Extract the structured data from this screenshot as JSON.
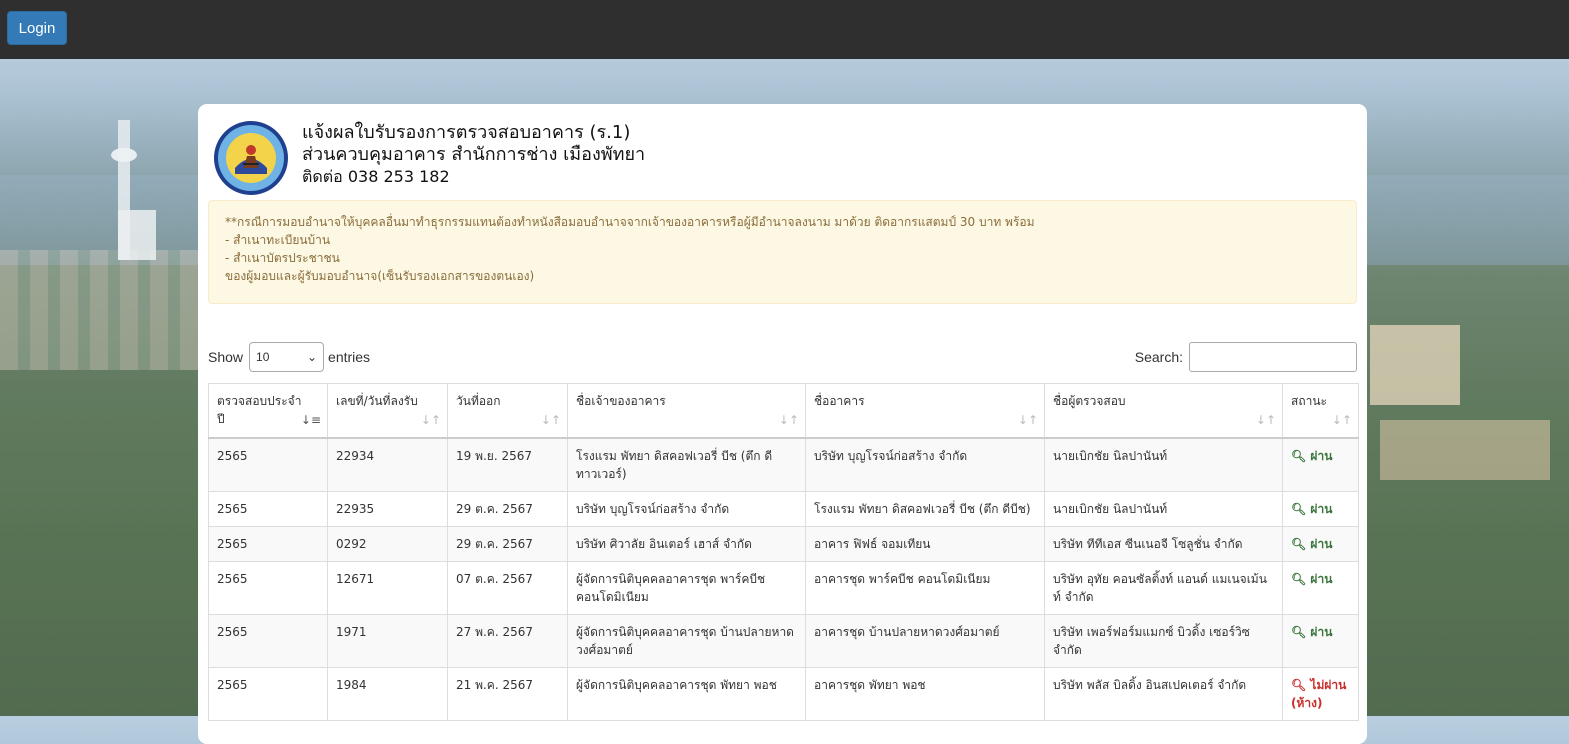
{
  "navbar": {
    "login_label": "Login"
  },
  "header": {
    "line1": "แจ้งผลใบรับรองการตรวจสอบอาคาร (ร.1)",
    "line2": "ส่วนควบคุมอาคาร สำนักการช่าง เมืองพัทยา",
    "contact": "ติดต่อ 038 253 182"
  },
  "notice": {
    "line1": "**กรณีการมอบอำนาจให้บุคคลอื่นมาทำธุรกรรมแทนต้องทำหนังสือมอบอำนาจจากเจ้าของอาคารหรือผู้มีอำนาจลงนาม มาด้วย ติดอากรแสตมป์ 30 บาท พร้อม",
    "line2": "- สำเนาทะเบียนบ้าน",
    "line3": "- สำเนาบัตรประชาชน",
    "line4": "ของผู้มอบและผู้รับมอบอำนาจ(เซ็นรับรองเอกสารของตนเอง)"
  },
  "controls": {
    "show_label": "Show",
    "show_value": "10",
    "entries_label": "entries",
    "search_label": "Search:",
    "search_value": ""
  },
  "table": {
    "headers": [
      "ตรวจสอบประจำปี",
      "เลขที่/วันที่ลงรับ",
      "วันที่ออก",
      "ชื่อเจ้าของอาคาร",
      "ชื่ออาคาร",
      "ชื่อผู้ตรวจสอบ",
      "สถานะ"
    ],
    "rows": [
      [
        "2565",
        "22934",
        "19 พ.ย. 2567",
        "โรงแรม พัทยา ดิสคอฟเวอรี่ บีช (ตึก ดีทาวเวอร์)",
        "บริษัท บุญโรจน์ก่อสร้าง จำกัด",
        "นายเบิกชัย นิลปานันท์",
        "ผ่าน"
      ],
      [
        "2565",
        "22935",
        "29 ต.ค. 2567",
        "บริษัท บุญโรจน์ก่อสร้าง จำกัด",
        "โรงแรม พัทยา ดิสคอฟเวอรี่ บีช (ตึก ดีบีช)",
        "นายเบิกชัย นิลปานันท์",
        "ผ่าน"
      ],
      [
        "2565",
        "0292",
        "29 ต.ค. 2567",
        "บริษัท ศิวาลัย อินเตอร์ เฮาส์ จำกัด",
        "อาคาร ฟิฟธ์ จอมเทียน",
        "บริษัท ทีทีเอส ซีนเนอจี โซลูชั่น จำกัด",
        "ผ่าน"
      ],
      [
        "2565",
        "12671",
        "07 ต.ค. 2567",
        "ผู้จัดการนิติบุคคลอาคารชุด พาร์คบีช คอนโดมิเนียม",
        "อาคารชุด พาร์คบีช คอนโดมิเนียม",
        "บริษัท อุทัย คอนซัลติ้งท์ แอนด์ แมเนจเม้นท์ จำกัด",
        "ผ่าน"
      ],
      [
        "2565",
        "1971",
        "27 พ.ค. 2567",
        "ผู้จัดการนิติบุคคลอาคารชุด บ้านปลายหาดวงศ์อมาตย์",
        "อาคารชุด บ้านปลายหาดวงศ์อมาตย์",
        "บริษัท เพอร์ฟอร์มแมกซ์ บิวดิ้ง เซอร์วิซ จำกัด",
        "ผ่าน"
      ],
      [
        "2565",
        "1984",
        "21 พ.ค. 2567",
        "ผู้จัดการนิติบุคคลอาคารชุด พัทยา พอช",
        "อาคารชุด พัทยา พอช",
        "บริษัท พลัส บิลดิ้ง อินสเปคเตอร์ จำกัด",
        "ไม่ผ่าน (ห้าง)"
      ]
    ],
    "status_colors": {
      "pass": "#3c763d",
      "fail": "#c9302c"
    }
  }
}
